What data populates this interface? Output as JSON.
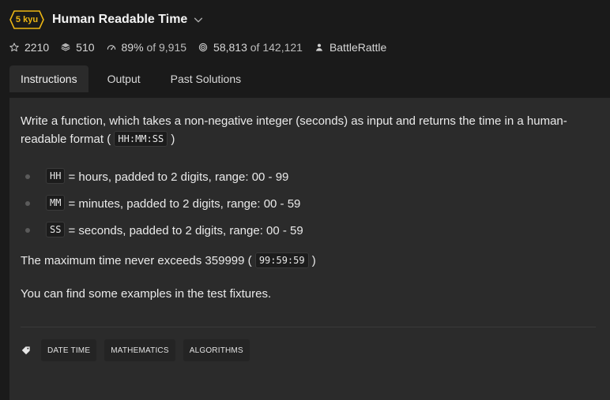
{
  "colors": {
    "background": "#1a1a1a",
    "panel": "#2b2b2b",
    "accent_kyu": "#ecb613"
  },
  "header": {
    "kyu_label": "5 kyu",
    "title": "Human Readable Time",
    "title_menu_icon": "chevron-down-icon"
  },
  "stats": {
    "stars": "2210",
    "collections": "510",
    "satisfaction_percent": "89%",
    "satisfaction_of": "of 9,915",
    "completed": "58,813",
    "attempted_of": "of 142,121",
    "author": "BattleRattle",
    "icons": [
      "star-icon",
      "layers-icon",
      "gauge-icon",
      "target-icon",
      "user-icon"
    ]
  },
  "tabs": [
    {
      "label": "Instructions",
      "active": true
    },
    {
      "label": "Output",
      "active": false
    },
    {
      "label": "Past Solutions",
      "active": false
    }
  ],
  "instructions": {
    "p1_text": "Write a function, which takes a non-negative integer (seconds) as input and returns the time in a human-readable format (",
    "p1_code": "HH:MM:SS",
    "p1_after": ")",
    "list": [
      {
        "code": "HH",
        "text": "= hours, padded to 2 digits, range: 00 - 99"
      },
      {
        "code": "MM",
        "text": "= minutes, padded to 2 digits, range: 00 - 59"
      },
      {
        "code": "SS",
        "text": "= seconds, padded to 2 digits, range: 00 - 59"
      }
    ],
    "p2_text": "The maximum time never exceeds 359999 (",
    "p2_code": "99:59:59",
    "p2_after": ")",
    "p3_text": "You can find some examples in the test fixtures."
  },
  "tags": {
    "icon": "tag-icon",
    "items": [
      "DATE TIME",
      "MATHEMATICS",
      "ALGORITHMS"
    ]
  }
}
